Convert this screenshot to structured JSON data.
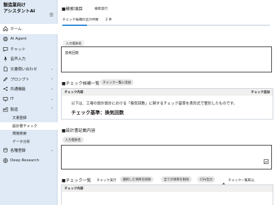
{
  "app": {
    "brand_line1": "製造業向け",
    "brand_line2": "アシスタントAI"
  },
  "sidebar": {
    "items": [
      {
        "label": "ホーム",
        "icon": "home-icon"
      },
      {
        "label": "AI Agent",
        "icon": "ai-agent-icon"
      },
      {
        "label": "チャット",
        "icon": "chat-icon"
      },
      {
        "label": "音声入力",
        "icon": "microphone-icon"
      },
      {
        "label": "文書問い合わせ",
        "icon": "document-icon"
      },
      {
        "label": "プロンプト",
        "icon": "pencil-icon"
      },
      {
        "label": "共通機能",
        "icon": "share-icon"
      },
      {
        "label": "IT",
        "icon": "monitor-icon"
      },
      {
        "label": "製造",
        "icon": "factory-icon"
      }
    ],
    "sub_items": [
      "文書登録",
      "設計書チェック",
      "規格検索",
      "データ分析"
    ],
    "bottom_items": [
      {
        "label": "各種登録",
        "icon": "database-icon"
      },
      {
        "label": "Deep Research",
        "icon": "globe-icon"
      }
    ]
  },
  "search_section": {
    "title": "■検索項目",
    "run_button": "検索実行",
    "count_label": "チェック候補の出力件数",
    "count_value": "2 件",
    "progress": 0.12,
    "input_tag": "入力値表名",
    "input_value": "換気回数"
  },
  "candidates_section": {
    "title": "■チェック候補一覧",
    "add_button": "チェック一覧に追加",
    "col_content": "チェック内容",
    "col_add": "チェック追加",
    "row_description": "以下は、工場の設計設計における「換気回数」に関するチェック基準を表形式で整形したものです。",
    "row_heading": "チェック基準：換気回数"
  },
  "design_section": {
    "title": "■設計書記載内容",
    "input_tag": "入力値表名"
  },
  "checklist_section": {
    "title": "■チェック一覧",
    "run_button": "チェック実行",
    "delete_selected": "選択した項目を削除",
    "delete_all": "全ての項目を削除",
    "csv_button": "CSV出力",
    "import_button": "チェック一覧取込",
    "col_content": "チェック内容"
  }
}
